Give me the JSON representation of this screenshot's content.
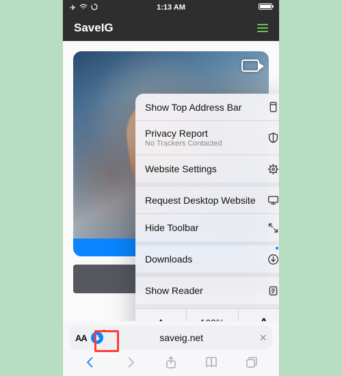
{
  "statusbar": {
    "time": "1:13 AM"
  },
  "site": {
    "title": "SaveIG"
  },
  "menu": {
    "show_top_address": "Show Top Address Bar",
    "privacy_report": "Privacy Report",
    "privacy_sub": "No Trackers Contacted",
    "website_settings": "Website Settings",
    "request_desktop": "Request Desktop Website",
    "hide_toolbar": "Hide Toolbar",
    "downloads": "Downloads",
    "show_reader": "Show Reader"
  },
  "zoom": {
    "smaller": "A",
    "percent": "100%",
    "bigger": "A"
  },
  "address": {
    "aa": "AA",
    "domain": "saveig.net"
  }
}
